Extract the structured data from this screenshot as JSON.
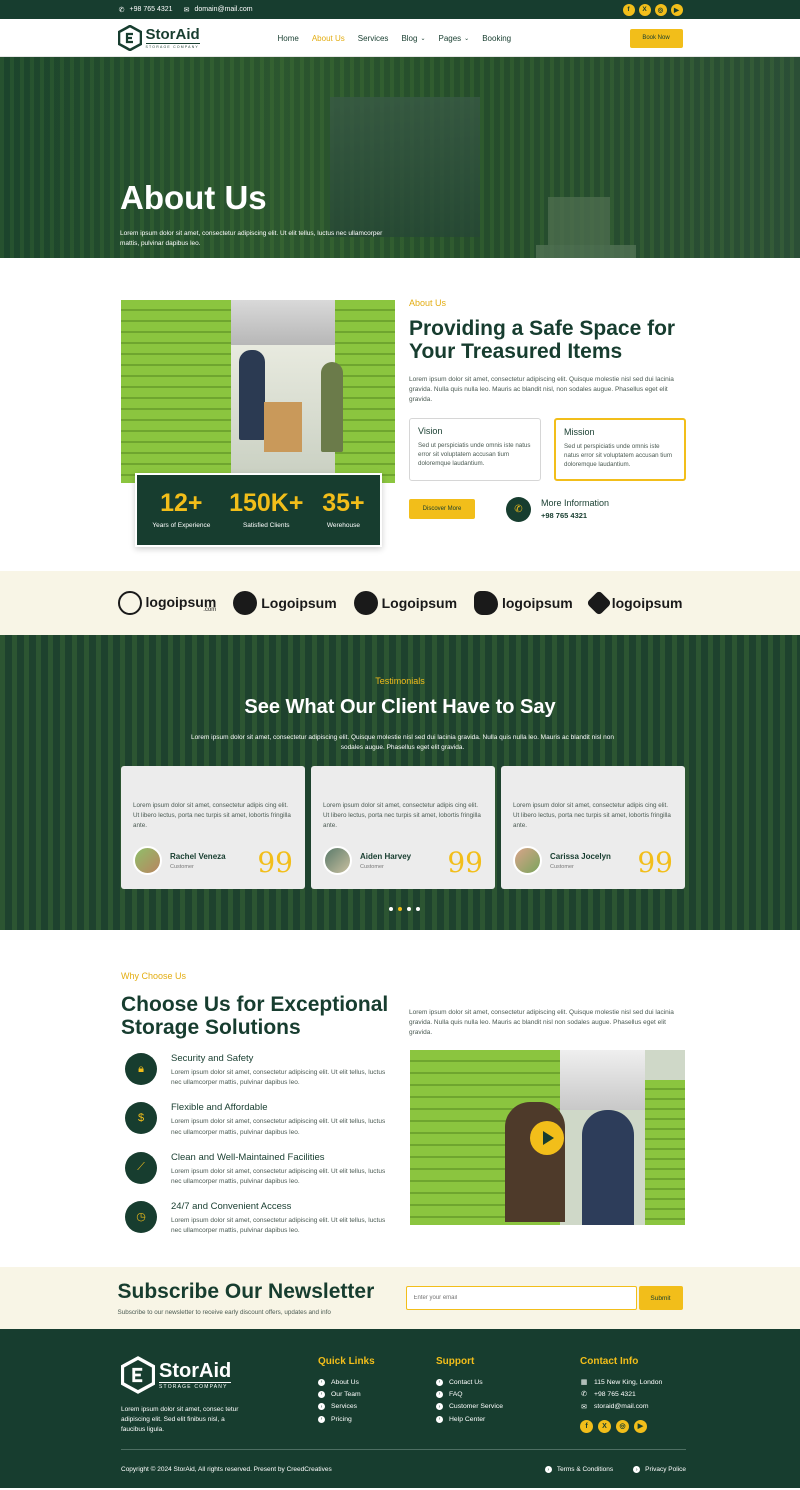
{
  "topbar": {
    "phone": "+98 765 4321",
    "email": "domain@mail.com",
    "social_icons": [
      "facebook-icon",
      "x-icon",
      "instagram-icon",
      "youtube-icon"
    ]
  },
  "brand": {
    "name": "StorAid",
    "tagline": "STORAGE COMPANY"
  },
  "nav": {
    "items": [
      "Home",
      "About Us",
      "Services",
      "Blog",
      "Pages",
      "Booking"
    ],
    "active": "About Us",
    "book_label": "Book Now"
  },
  "hero": {
    "title": "About Us",
    "text": "Lorem ipsum dolor sit amet, consectetur adipiscing elit. Ut elit tellus, luctus nec ullamcorper mattis, pulvinar dapibus leo."
  },
  "about": {
    "eyebrow": "About Us",
    "title": "Providing a Safe Space for Your Treasured Items",
    "desc": "Lorem ipsum dolor sit amet, consectetur adipiscing elit. Quisque molestie nisl sed dui lacinia gravida. Nulla quis nulla leo. Mauris ac blandit nisl, non sodales augue. Phasellus eget elit gravida.",
    "stats": [
      {
        "num": "12+",
        "label": "Years of Experience"
      },
      {
        "num": "150K+",
        "label": "Satisfied Clients"
      },
      {
        "num": "35+",
        "label": "Werehouse"
      }
    ],
    "vision": {
      "title": "Vision",
      "text": "Sed ut perspiciatis unde omnis iste natus error sit voluptatem accusan tium doloremque laudantium."
    },
    "mission": {
      "title": "Mission",
      "text": "Sed ut perspiciatis unde omnis iste natus error sit voluptatem accusan tium doloremque laudantium."
    },
    "discover_label": "Discover More",
    "info_title": "More Information",
    "info_phone": "+98 765 4321"
  },
  "logos": [
    {
      "text": "logoipsum",
      "sub": ".com"
    },
    {
      "text": "Logoipsum",
      "sub": ""
    },
    {
      "text": "Logoipsum",
      "sub": ""
    },
    {
      "text": "logoipsum",
      "sub": ""
    },
    {
      "text": "logoipsum",
      "sub": ""
    }
  ],
  "testimonials": {
    "eyebrow": "Testimonials",
    "title": "See What Our Client Have to Say",
    "desc": "Lorem ipsum dolor sit amet, consectetur adipiscing elit. Quisque molestie nisl sed dui lacinia gravida. Nulla quis nulla leo. Mauris ac blandit nisl non sodales augue. Phasellus eget elit gravida.",
    "cards": [
      {
        "text": "Lorem ipsum dolor sit amet, consectetur adipis cing elit. Ut libero lectus, porta nec turpis sit amet, lobortis fringilla ante.",
        "name": "Rachel Veneza",
        "role": "Customer"
      },
      {
        "text": "Lorem ipsum dolor sit amet, consectetur adipis cing elit. Ut libero lectus, porta nec turpis sit amet, lobortis fringilla ante.",
        "name": "Aiden Harvey",
        "role": "Customer"
      },
      {
        "text": "Lorem ipsum dolor sit amet, consectetur adipis cing elit. Ut libero lectus, porta nec turpis sit amet, lobortis fringilla ante.",
        "name": "Carissa Jocelyn",
        "role": "Customer"
      }
    ],
    "quote_glyph": "99",
    "slider_dots": 4,
    "active_dot": 2
  },
  "why": {
    "eyebrow": "Why Choose Us",
    "title": "Choose Us for Exceptional Storage Solutions",
    "desc": "Lorem ipsum dolor sit amet, consectetur adipiscing elit. Quisque molestie nisl sed dui lacinia gravida. Nulla quis nulla leo. Mauris ac blandit nisl non sodales augue. Phasellus eget elit gravida.",
    "features": [
      {
        "icon": "lock-icon",
        "title": "Security and Safety",
        "text": "Lorem ipsum dolor sit amet, consectetur adipiscing elit. Ut elit tellus, luctus nec ullamcorper mattis, pulvinar dapibus leo."
      },
      {
        "icon": "money-bag-icon",
        "title": "Flexible and Affordable",
        "text": "Lorem ipsum dolor sit amet, consectetur adipiscing elit. Ut elit tellus, luctus nec ullamcorper mattis, pulvinar dapibus leo."
      },
      {
        "icon": "broom-icon",
        "title": "Clean and Well-Maintained Facilities",
        "text": "Lorem ipsum dolor sit amet, consectetur adipiscing elit. Ut elit tellus, luctus nec ullamcorper mattis, pulvinar dapibus leo."
      },
      {
        "icon": "clock-icon",
        "title": "24/7 and Convenient Access",
        "text": "Lorem ipsum dolor sit amet, consectetur adipiscing elit. Ut elit tellus, luctus nec ullamcorper mattis, pulvinar dapibus leo."
      }
    ]
  },
  "newsletter": {
    "title": "Subscribe Our Newsletter",
    "sub": "Subscribe to our newsletter to receive early discount offers, updates and info",
    "placeholder": "Enter your email",
    "button": "Submit"
  },
  "footer": {
    "about": "Lorem ipsum dolor sit amet, consec tetur adipiscing elit. Sed elit finibus nisl, a faucibus ligula.",
    "quick_title": "Quick Links",
    "quick": [
      "About Us",
      "Our Team",
      "Services",
      "Pricing"
    ],
    "support_title": "Support",
    "support": [
      "Contact Us",
      "FAQ",
      "Customer Service",
      "Help Center"
    ],
    "contact_title": "Contact Info",
    "contact": [
      "115 New King, London",
      "+98 765 4321",
      "storaid@mail.com"
    ],
    "copyright": "Copyright © 2024 StorAid, All rights reserved. Present by CreedCreatives",
    "legal": [
      "Terms & Conditions",
      "Privacy Police"
    ]
  },
  "colors": {
    "primary": "#173d2f",
    "accent": "#f2be1a",
    "cream": "#f8f5e6"
  }
}
